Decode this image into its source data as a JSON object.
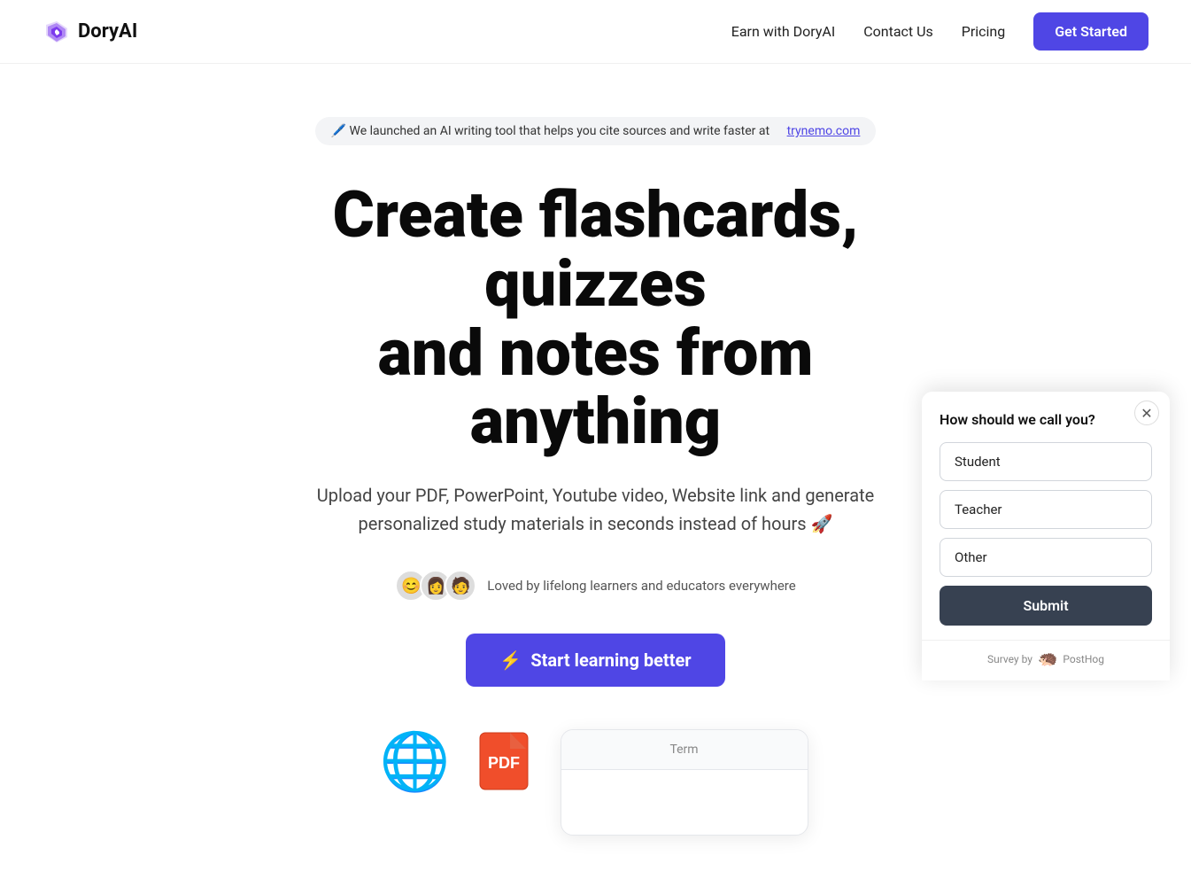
{
  "header": {
    "logo_text": "DoryAI",
    "nav": {
      "earn": "Earn with DoryAI",
      "contact": "Contact Us",
      "pricing": "Pricing",
      "cta": "Get Started"
    }
  },
  "hero": {
    "announcement": "🖊️ We launched an AI writing tool that helps you cite sources and write faster at",
    "announcement_link_text": "trynemo.com",
    "announcement_link_href": "#",
    "title_line1": "Create flashcards, quizzes",
    "title_line2": "and notes from anything",
    "subtitle": "Upload your PDF, PowerPoint, Youtube video, Website link and generate personalized study materials in seconds instead of hours 🚀",
    "loved_text": "Loved by lifelong learners and educators everywhere",
    "cta_button": "Start learning better",
    "cta_icon": "⚡"
  },
  "flashcard": {
    "label": "Term",
    "placeholder": ""
  },
  "survey": {
    "question": "How should we call you?",
    "options": [
      "Student",
      "Teacher",
      "Other"
    ],
    "submit_label": "Submit",
    "footer_text": "Survey by",
    "footer_brand": "PostHog"
  },
  "icons": {
    "globe": "🌐",
    "pdf": "📄"
  }
}
